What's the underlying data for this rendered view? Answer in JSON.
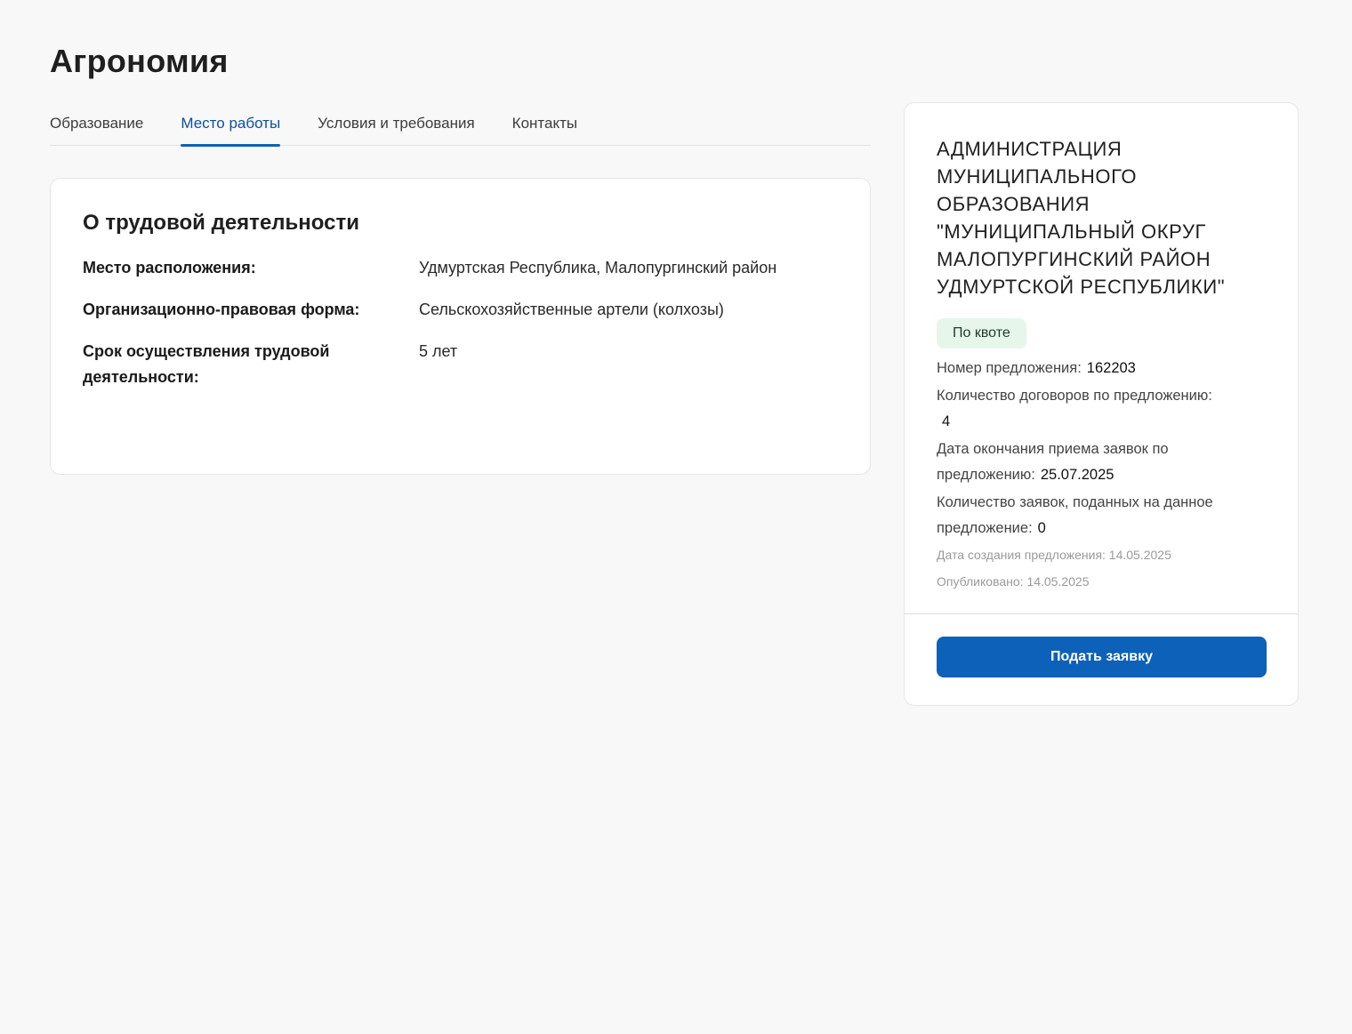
{
  "page": {
    "title": "Агрономия"
  },
  "tabs": [
    {
      "label": "Образование"
    },
    {
      "label": "Место работы"
    },
    {
      "label": "Условия и требования"
    },
    {
      "label": "Контакты"
    }
  ],
  "active_tab": "Место работы",
  "work_info": {
    "heading": "О трудовой деятельности",
    "rows": [
      {
        "label": "Место расположения:",
        "value": "Удмуртская Республика, Малопургинский район"
      },
      {
        "label": "Организационно-правовая форма:",
        "value": "Сельскохозяйственные артели (колхозы)"
      },
      {
        "label": "Срок осуществления трудовой деятельности:",
        "value": "5 лет"
      }
    ]
  },
  "sidebar": {
    "organization": "АДМИНИСТРАЦИЯ МУНИЦИПАЛЬНОГО ОБРАЗОВАНИЯ \"МУНИЦИПАЛЬНЫЙ ОКРУГ МАЛОПУРГИНСКИЙ РАЙОН УДМУРТСКОЙ РЕСПУБЛИКИ\"",
    "badge": "По квоте",
    "offer_number_label": "Номер предложения:",
    "offer_number": "162203",
    "contracts_label": "Количество договоров по предложению:",
    "contracts": "4",
    "deadline_label": "Дата окончания приема заявок по предложению:",
    "deadline": "25.07.2025",
    "applications_label": "Количество заявок, поданных на данное предложение:",
    "applications": "0",
    "created": "Дата создания предложения: 14.05.2025",
    "published": "Опубликовано: 14.05.2025",
    "apply_button": "Подать заявку"
  },
  "colors": {
    "accent": "#0d61b8",
    "badge_bg": "#e6f7ea",
    "page_bg": "#f8f8f8"
  }
}
